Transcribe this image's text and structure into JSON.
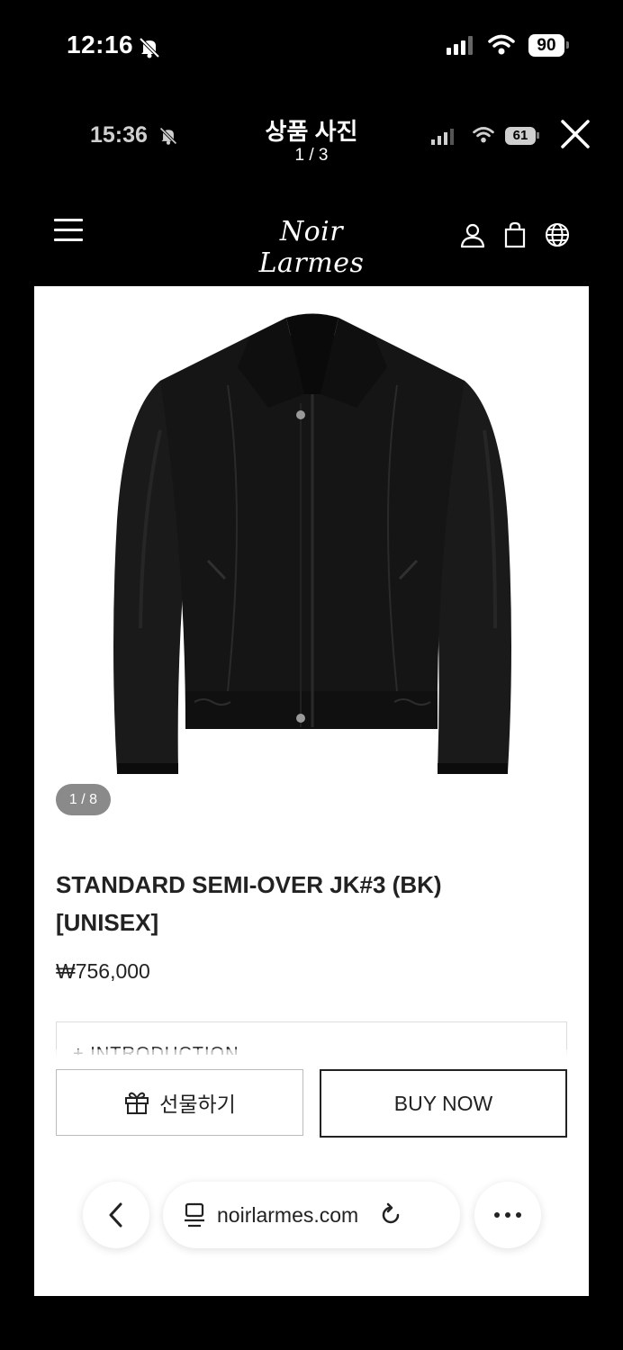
{
  "status_outer": {
    "time": "12:16",
    "battery": "90"
  },
  "status_inner": {
    "time": "15:36",
    "battery": "61"
  },
  "viewer": {
    "title": "상품 사진",
    "counter": "1 / 3"
  },
  "site": {
    "logo": "Noir Larmes"
  },
  "product": {
    "photo_counter": "1 / 8",
    "title_line1": "STANDARD SEMI-OVER JK#3 (BK)",
    "title_line2": "[UNISEX]",
    "price": "₩756,000",
    "intro_label": "+ INTRODUCTION"
  },
  "actions": {
    "gift_label": "선물하기",
    "buy_label": "BUY NOW"
  },
  "browser": {
    "url": "noirlarmes.com"
  },
  "icons": [
    "bell-muted-icon",
    "signal-icon",
    "wifi-icon",
    "battery-icon",
    "close-icon",
    "menu-icon",
    "user-icon",
    "shopping-bag-icon",
    "globe-icon",
    "gift-icon",
    "back-chevron-icon",
    "reader-icon",
    "reload-icon",
    "more-icon"
  ],
  "colors": {
    "background": "#000000",
    "page": "#ffffff",
    "text": "#222222",
    "badge": "#8a8a8a"
  }
}
